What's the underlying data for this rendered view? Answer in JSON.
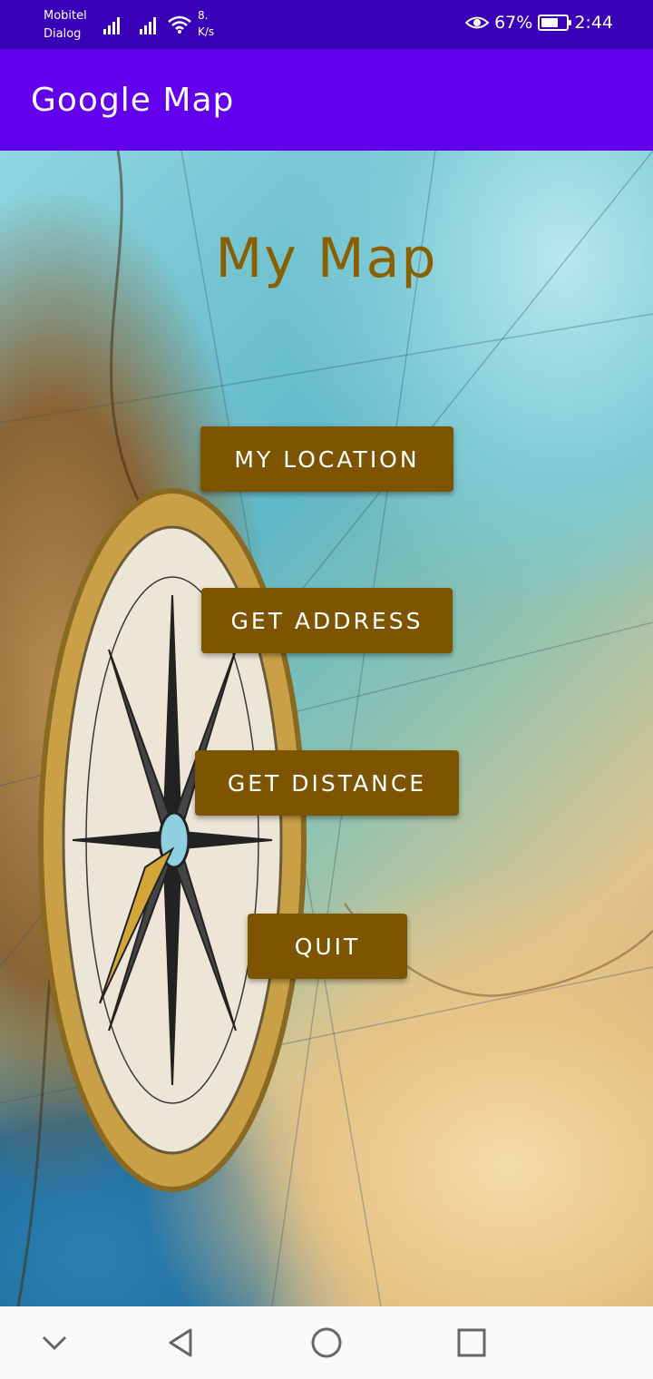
{
  "status_bar": {
    "carrier_line1": "Mobitel",
    "carrier_line2": "Dialog",
    "speed_line1": "8.",
    "speed_line2": "K/s",
    "battery_percent": "67%",
    "battery_level": 0.67,
    "time": "2:44",
    "icons": [
      "signal-icon",
      "signal-icon",
      "wifi-icon",
      "eye-icon",
      "battery-icon"
    ]
  },
  "app_bar": {
    "title": "Google Map"
  },
  "main": {
    "heading": "My Map",
    "buttons": {
      "my_location": "MY LOCATION",
      "get_address": "GET ADDRESS",
      "get_distance": "GET DISTANCE",
      "quit": "QUIT"
    }
  },
  "nav_bar": {
    "icons": [
      "chevron-down-icon",
      "back-icon",
      "home-icon",
      "recents-icon"
    ]
  },
  "colors": {
    "status_bar": "#3a00b8",
    "app_bar": "#6200ee",
    "button": "#7d5500",
    "heading": "#8a5f00"
  }
}
